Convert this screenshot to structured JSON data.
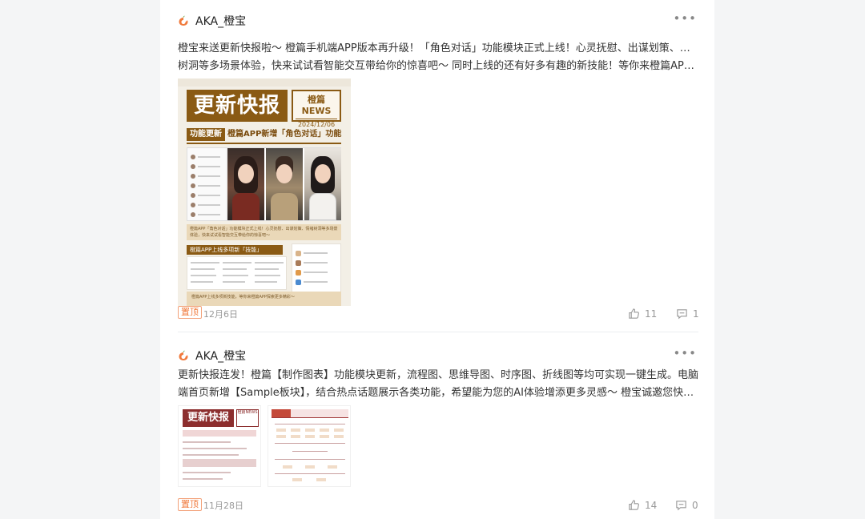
{
  "posts": [
    {
      "author": "AKA_橙宝",
      "text_line1": "橙宝来送更新快报啦～ 橙篇手机端APP版本再升级！「角色对话」功能模块正式上线！心灵抚慰、出谋划策、情绪",
      "text_line2": "树洞等多场景体验，快来试试看智能交互带给你的惊喜吧～ 同时上线的还有好多有趣的新技能！等你来橙篇APP...",
      "image": {
        "title": "更新快报",
        "news_label": "橙篇NEWS",
        "news_date": "2024/12/06",
        "func_tag": "功能更新",
        "func_text": "橙篇APP新增「角色对话」功能",
        "desc": "橙篇APP「角色对话」功能模块正式上线！心灵抚慰、出谋划策、情绪树洞等多场景体验，快来试试看智能交互带给你的惊喜吧～",
        "section_tag": "橙篇APP上线多项新「技能」",
        "footer": "橙篇APP上线多项新技能，等你来橙篇APP探索更多精彩～"
      },
      "pin_label": "置顶",
      "date": "12月6日",
      "likes": "11",
      "comments": "1"
    },
    {
      "author": "AKA_橙宝",
      "text_line1": "更新快报连发！橙篇【制作图表】功能模块更新，流程图、思维导图、时序图、折线图等均可实现一键生成。电脑",
      "text_line2": "端首页新增【Sample板块】，结合热点话题展示各类功能，希望能为您的AI体验增添更多灵感～ 橙宝诚邀您快来...",
      "thumb_title": "更新快报",
      "thumb_news": "橙篇NEWS",
      "pin_label": "置顶",
      "date": "11月28日",
      "likes": "14",
      "comments": "0"
    }
  ],
  "icons": {
    "more": "more-dots-icon",
    "like": "thumbs-up-icon",
    "comment": "comment-icon",
    "avatar": "orange-logo-icon"
  },
  "colors": {
    "accent": "#f07a3c",
    "poster_brown": "#8a5a14",
    "thumb_red": "#8c2e2e"
  }
}
